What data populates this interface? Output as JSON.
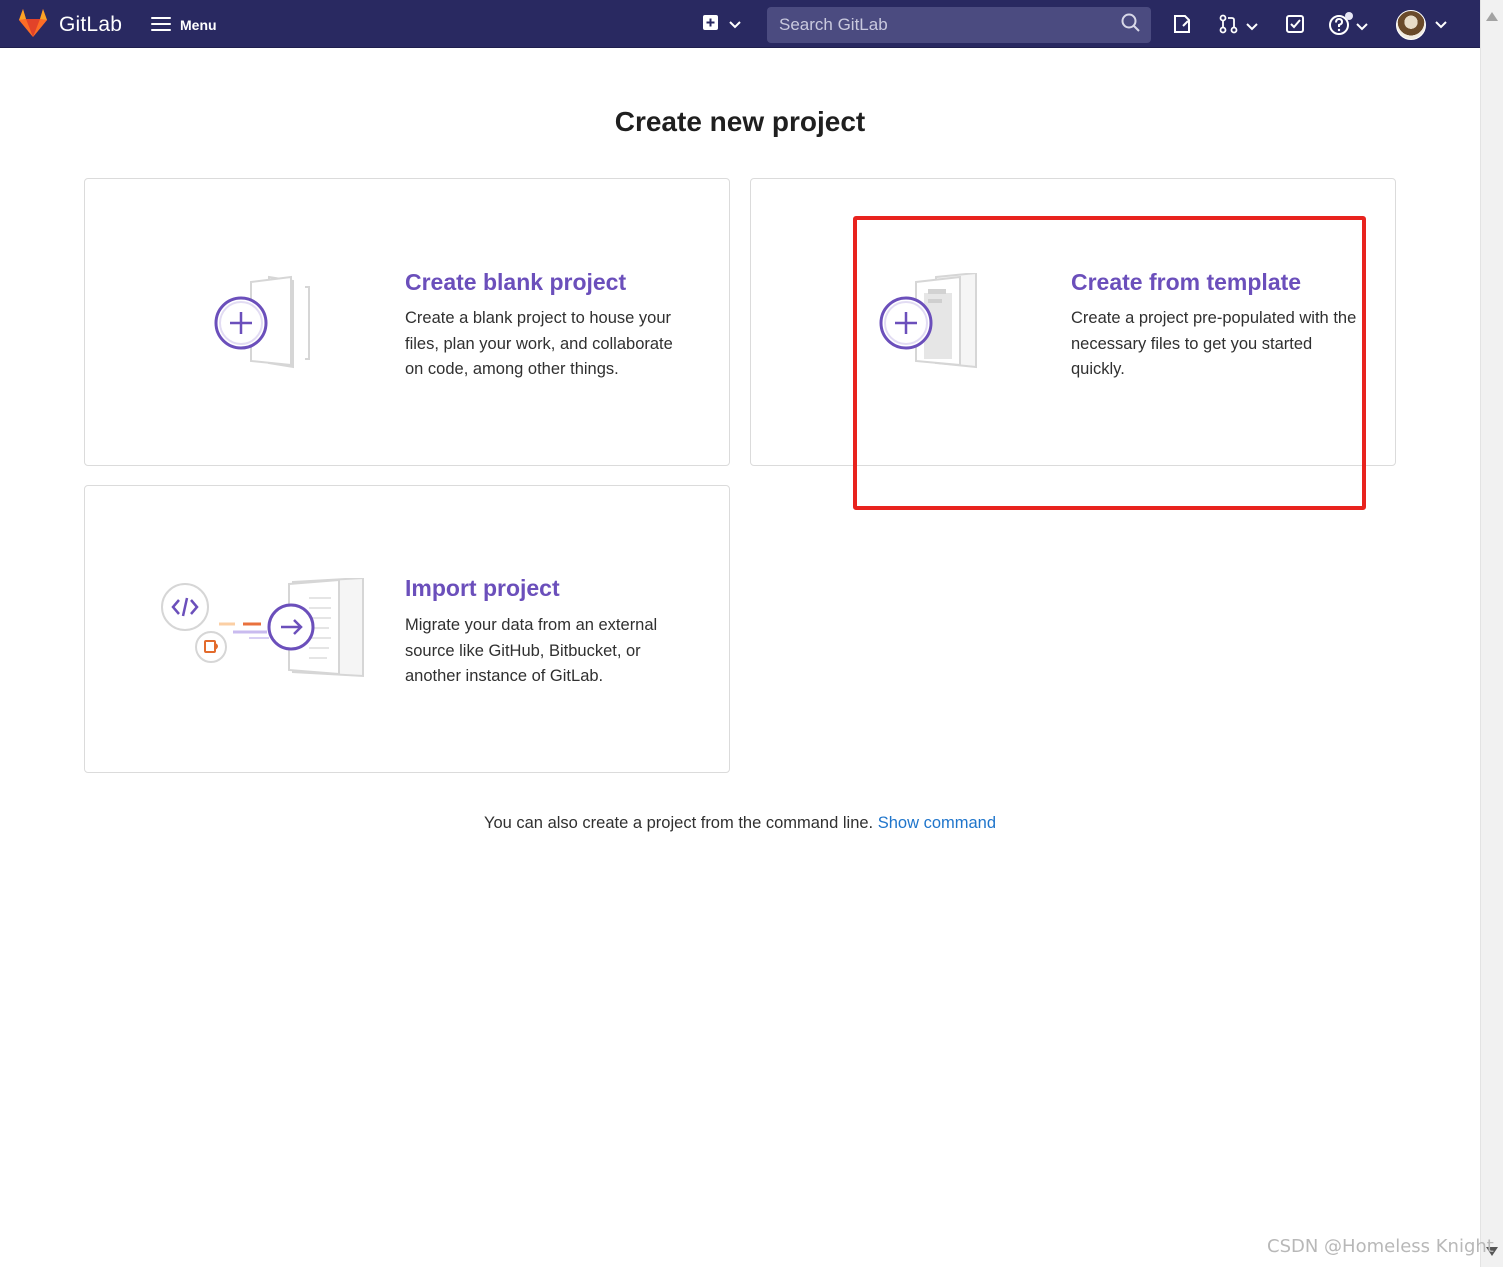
{
  "navbar": {
    "brand": "GitLab",
    "menu_label": "Menu",
    "search_placeholder": "Search GitLab",
    "icons": [
      "gitlab-logo-icon",
      "hamburger-icon",
      "plus-square-icon",
      "chevron-down-icon",
      "search-icon",
      "issues-icon",
      "merge-request-icon",
      "todo-icon",
      "help-icon",
      "avatar"
    ]
  },
  "page": {
    "title": "Create new project"
  },
  "panels": [
    {
      "title": "Create blank project",
      "description": "Create a blank project to house your files, plan your work, and collaborate on code, among other things."
    },
    {
      "title": "Create from template",
      "description": "Create a project pre-populated with the necessary files to get you started quickly."
    },
    {
      "title": "Import project",
      "description": "Migrate your data from an external source like GitHub, Bitbucket, or another instance of GitLab."
    }
  ],
  "cli": {
    "text": "You can also create a project from the command line.",
    "link": "Show command"
  },
  "colors": {
    "navbar": "#292961",
    "accent": "#6b4fbb",
    "link": "#1f75cb",
    "highlight": "#e8231e"
  },
  "watermark": "CSDN @Homeless Knight"
}
